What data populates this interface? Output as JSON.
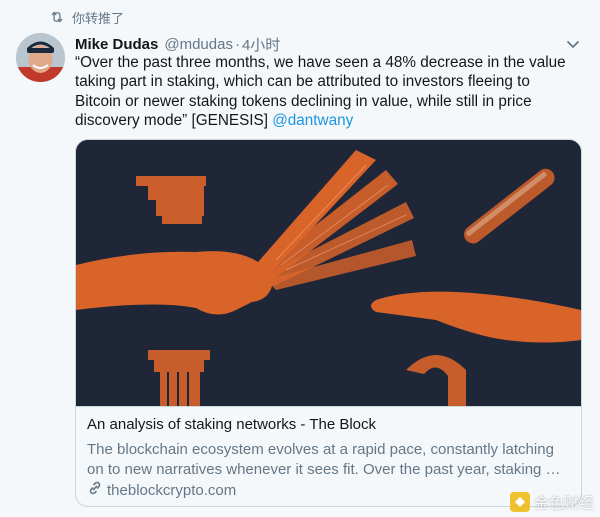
{
  "retweet": {
    "label": "你转推了",
    "icon": "retweet-icon"
  },
  "author": {
    "name": "Mike Dudas",
    "handle": "@mdudas",
    "separator": "·",
    "time": "4小时"
  },
  "tweet": {
    "text": "“Over the past three months, we have seen a 48% decrease in the value taking part in staking, which can be attributed to investors fleeing to Bitcoin or newer staking tokens declining in value, while still in price discovery mode” [GENESIS]",
    "mention": "@dantwany"
  },
  "card": {
    "title": "An analysis of staking networks - The Block",
    "description": "The blockchain ecosystem evolves at a rapid pace, constantly latching on to new narratives whenever it sees fit. Over the past year, staking …",
    "domain": "theblockcrypto.com",
    "image_palette": {
      "background": "#1e2637",
      "accent": "#d9642a"
    }
  },
  "watermark": {
    "text": "金色财经"
  },
  "colors": {
    "link": "#1b95e0",
    "muted": "#657786",
    "text": "#14171a"
  }
}
